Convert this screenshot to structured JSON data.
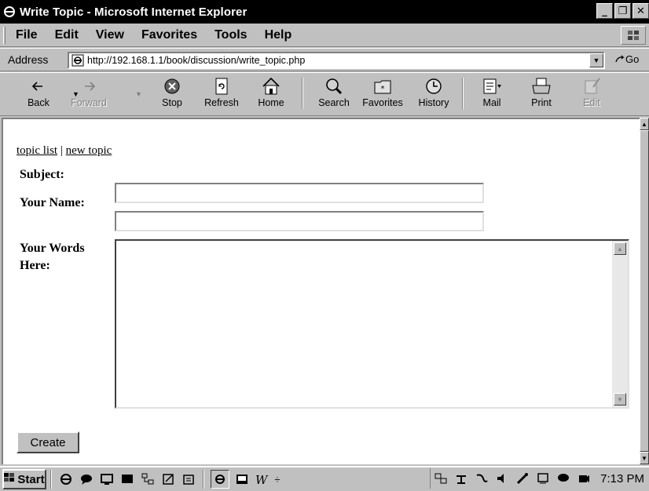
{
  "window": {
    "title": "Write Topic - Microsoft Internet Explorer",
    "buttons": [
      "_",
      "ő",
      "✕"
    ]
  },
  "menu": {
    "items": [
      "File",
      "Edit",
      "View",
      "Favorites",
      "Tools",
      "Help"
    ]
  },
  "address": {
    "label": "Address",
    "url": "http://192.168.1.1/book/discussion/write_topic.php",
    "go_label": "Go"
  },
  "toolbar": {
    "buttons": [
      {
        "label": "Back",
        "icon": "back-arrow-icon"
      },
      {
        "label": "Forward",
        "icon": "forward-arrow-icon",
        "disabled": true
      },
      {
        "label": "Stop",
        "icon": "stop-icon"
      },
      {
        "label": "Refresh",
        "icon": "refresh-icon"
      },
      {
        "label": "Home",
        "icon": "home-icon"
      },
      {
        "label": "Search",
        "icon": "search-icon"
      },
      {
        "label": "Favorites",
        "icon": "favorites-icon"
      },
      {
        "label": "History",
        "icon": "history-icon"
      },
      {
        "label": "Mail",
        "icon": "mail-icon"
      },
      {
        "label": "Print",
        "icon": "print-icon"
      },
      {
        "label": "Edit",
        "icon": "edit-icon",
        "disabled": true
      }
    ]
  },
  "page": {
    "nav": {
      "topic_list": "topic list",
      "separator": "|",
      "new_topic": "new topic"
    },
    "form": {
      "subject_label": "Subject:",
      "subject_value": "",
      "name_label": "Your Name:",
      "name_value": "",
      "words_label_line1": "Your Words",
      "words_label_line2": "Here:",
      "words_value": "",
      "submit_label": "Create"
    }
  },
  "taskbar": {
    "start_label": "Start",
    "clock": "7:13 PM"
  }
}
